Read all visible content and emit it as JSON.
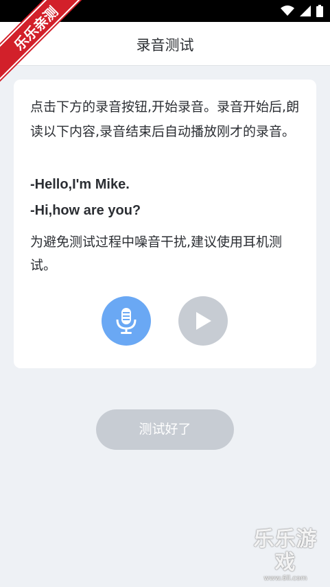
{
  "nav": {
    "title": "录音测试"
  },
  "card": {
    "instruction": "点击下方的录音按钮,开始录音。录音开始后,朗读以下内容,录音结束后自动播放刚才的录音。",
    "phrases": [
      "-Hello,I'm Mike.",
      "-Hi,how are you?"
    ],
    "note": "为避免测试过程中噪音干扰,建议使用耳机测试。",
    "record_icon": "microphone-icon",
    "play_icon": "play-icon"
  },
  "done_button": {
    "label": "测试好了"
  },
  "overlay": {
    "ribbon_text": "乐乐亲测",
    "watermark_text": "乐乐游戏",
    "watermark_url": "www.6ll.com"
  },
  "colors": {
    "background": "#eef1f5",
    "record_button": "#6aa8f4",
    "disabled_button": "#c7ccd3"
  }
}
